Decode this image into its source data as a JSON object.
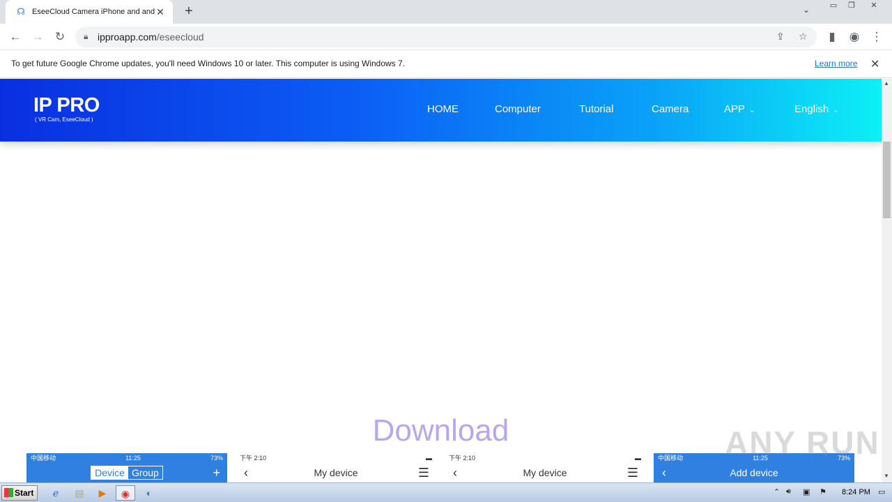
{
  "browser": {
    "tab_title": "EseeCloud Camera iPhone and android",
    "url_host": "ipproapp.com",
    "url_path": "/eseecloud",
    "infobar_message": "To get future Google Chrome updates, you'll need Windows 10 or later. This computer is using Windows 7.",
    "infobar_link": "Learn more"
  },
  "site": {
    "logo_main": "IP PRO",
    "logo_sub": "( VR Cam, EseeCloud )",
    "nav": [
      "HOME",
      "Computer",
      "Tutorial",
      "Camera",
      "APP",
      "English"
    ],
    "section_heading": "Download"
  },
  "screenshots": [
    {
      "carrier": "中国移动",
      "time": "11:25",
      "battery": "73%",
      "tab_device": "Device",
      "tab_group": "Group"
    },
    {
      "time": "下午 2:10",
      "title": "My device"
    },
    {
      "time": "下午 2:10",
      "title": "My device"
    },
    {
      "carrier": "中国移动",
      "time": "11:25",
      "battery": "73%",
      "title": "Add device"
    }
  ],
  "watermark": "ANY RUN",
  "taskbar": {
    "start_label": "Start",
    "clock": "8:24 PM"
  },
  "colors": {
    "header_gradient_start": "#0a2fe0",
    "header_gradient_end": "#0cf0f5",
    "download_heading": "#b7a6f0",
    "link": "#1a73e8"
  }
}
